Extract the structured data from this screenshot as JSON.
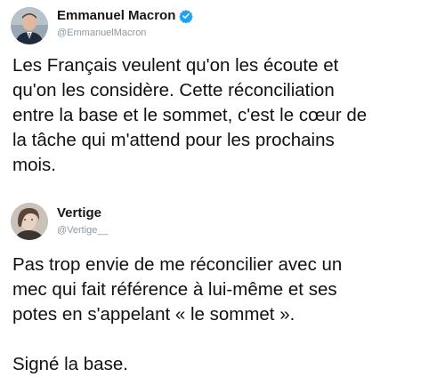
{
  "tweets": [
    {
      "display_name": "Emmanuel Macron",
      "handle": "@EmmanuelMacron",
      "verified": true,
      "verified_color": "#1da1f2",
      "avatar_icon": "avatar-photo-icon",
      "text": "Les Français veulent qu'on les écoute et\nqu'on les considère. Cette réconciliation\nentre la base et le sommet, c'est le cœur de\nla tâche qui m'attend pour les prochains\nmois."
    },
    {
      "display_name": "Vertige",
      "handle": "@Vertige__",
      "verified": false,
      "avatar_icon": "avatar-photo-icon",
      "text": "Pas trop envie de me réconcilier avec un\nmec qui fait référence à lui-même et ses\npotes en s'appelant « le sommet ».\n\nSigné la base."
    }
  ]
}
